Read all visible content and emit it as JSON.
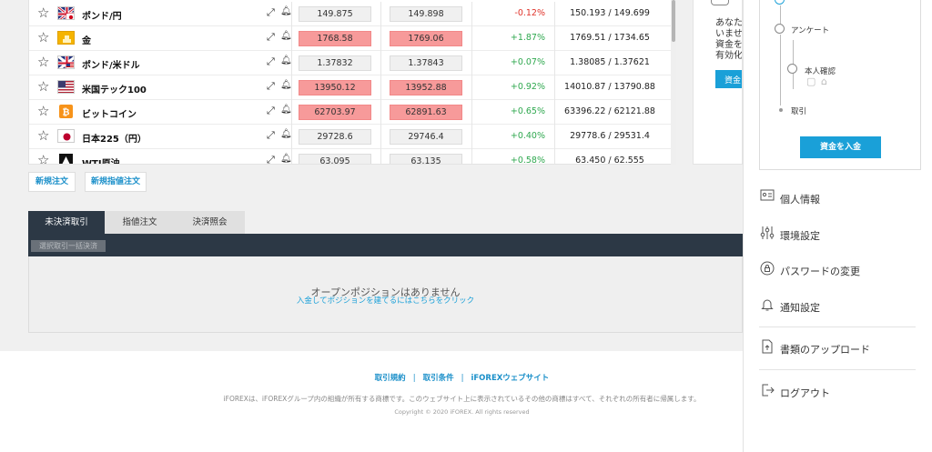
{
  "rates": [
    {
      "name": "ポンド/円",
      "flag": "gbp-jpy",
      "bid": "149.875",
      "ask": "149.898",
      "bid_up": false,
      "ask_up": false,
      "change": "-0.12%",
      "dir": "neg",
      "hilo": "150.193 / 149.699"
    },
    {
      "name": "金",
      "flag": "gold",
      "bid": "1768.58",
      "ask": "1769.06",
      "bid_up": true,
      "ask_up": true,
      "change": "+1.87%",
      "dir": "pos",
      "hilo": "1769.51 / 1734.65"
    },
    {
      "name": "ポンド/米ドル",
      "flag": "gbp-usd",
      "bid": "1.37832",
      "ask": "1.37843",
      "bid_up": false,
      "ask_up": false,
      "change": "+0.07%",
      "dir": "pos",
      "hilo": "1.38085 / 1.37621"
    },
    {
      "name": "米国テック100",
      "flag": "us",
      "bid": "13950.12",
      "ask": "13952.88",
      "bid_up": true,
      "ask_up": true,
      "change": "+0.92%",
      "dir": "pos",
      "hilo": "14010.87 / 13790.88"
    },
    {
      "name": "ビットコイン",
      "flag": "btc",
      "bid": "62703.97",
      "ask": "62891.63",
      "bid_up": true,
      "ask_up": true,
      "change": "+0.65%",
      "dir": "pos",
      "hilo": "63396.22 / 62121.88"
    },
    {
      "name": "日本225（円）",
      "flag": "jp",
      "bid": "29728.6",
      "ask": "29746.4",
      "bid_up": false,
      "ask_up": false,
      "change": "+0.40%",
      "dir": "pos",
      "hilo": "29778.6 / 29531.4"
    },
    {
      "name": "WTI原油",
      "flag": "oil",
      "bid": "63.095",
      "ask": "63.135",
      "bid_up": false,
      "ask_up": false,
      "change": "+0.58%",
      "dir": "pos",
      "hilo": "63.450 / 62.555"
    }
  ],
  "side_card": {
    "lines": [
      "あなたの",
      "いませ",
      "資金を",
      "有効化"
    ],
    "deposit_mini": "資金を"
  },
  "order_buttons": {
    "new_order": "新規注文",
    "new_limit_order": "新規指値注文"
  },
  "tabs": {
    "open": "未決済取引",
    "limit": "指値注文",
    "history": "決済照会"
  },
  "close_selected": "選択取引一括決済",
  "positions": {
    "empty": "オープンポジションはありません",
    "link": "入金してポジションを建てるにはこちらをクリック"
  },
  "steps": {
    "survey": "アンケート",
    "identity": "本人確認",
    "trade": "取引",
    "deposit_button": "資金を入金"
  },
  "menu": {
    "profile": "個人情報",
    "settings": "環境設定",
    "password": "パスワードの変更",
    "notifications": "通知設定",
    "upload": "書類のアップロード",
    "logout": "ログアウト"
  },
  "footer": {
    "terms": "取引規約",
    "conditions": "取引条件",
    "website": "iFOREXウェブサイト",
    "disclaimer": "iFOREXは、iFOREXグループ内の組織が所有する商標です。このウェブサイト上に表示されているその他の商標はすべて、それぞれの所有者に帰属します。",
    "copyright": "Copyright © 2020 iFOREX. All rights reserved"
  },
  "colors": {
    "accent": "#1aa0d8",
    "dark_bar": "#2c3845",
    "price_up": "#f79a9a",
    "positive": "#2fa84f",
    "negative": "#e0342b"
  }
}
